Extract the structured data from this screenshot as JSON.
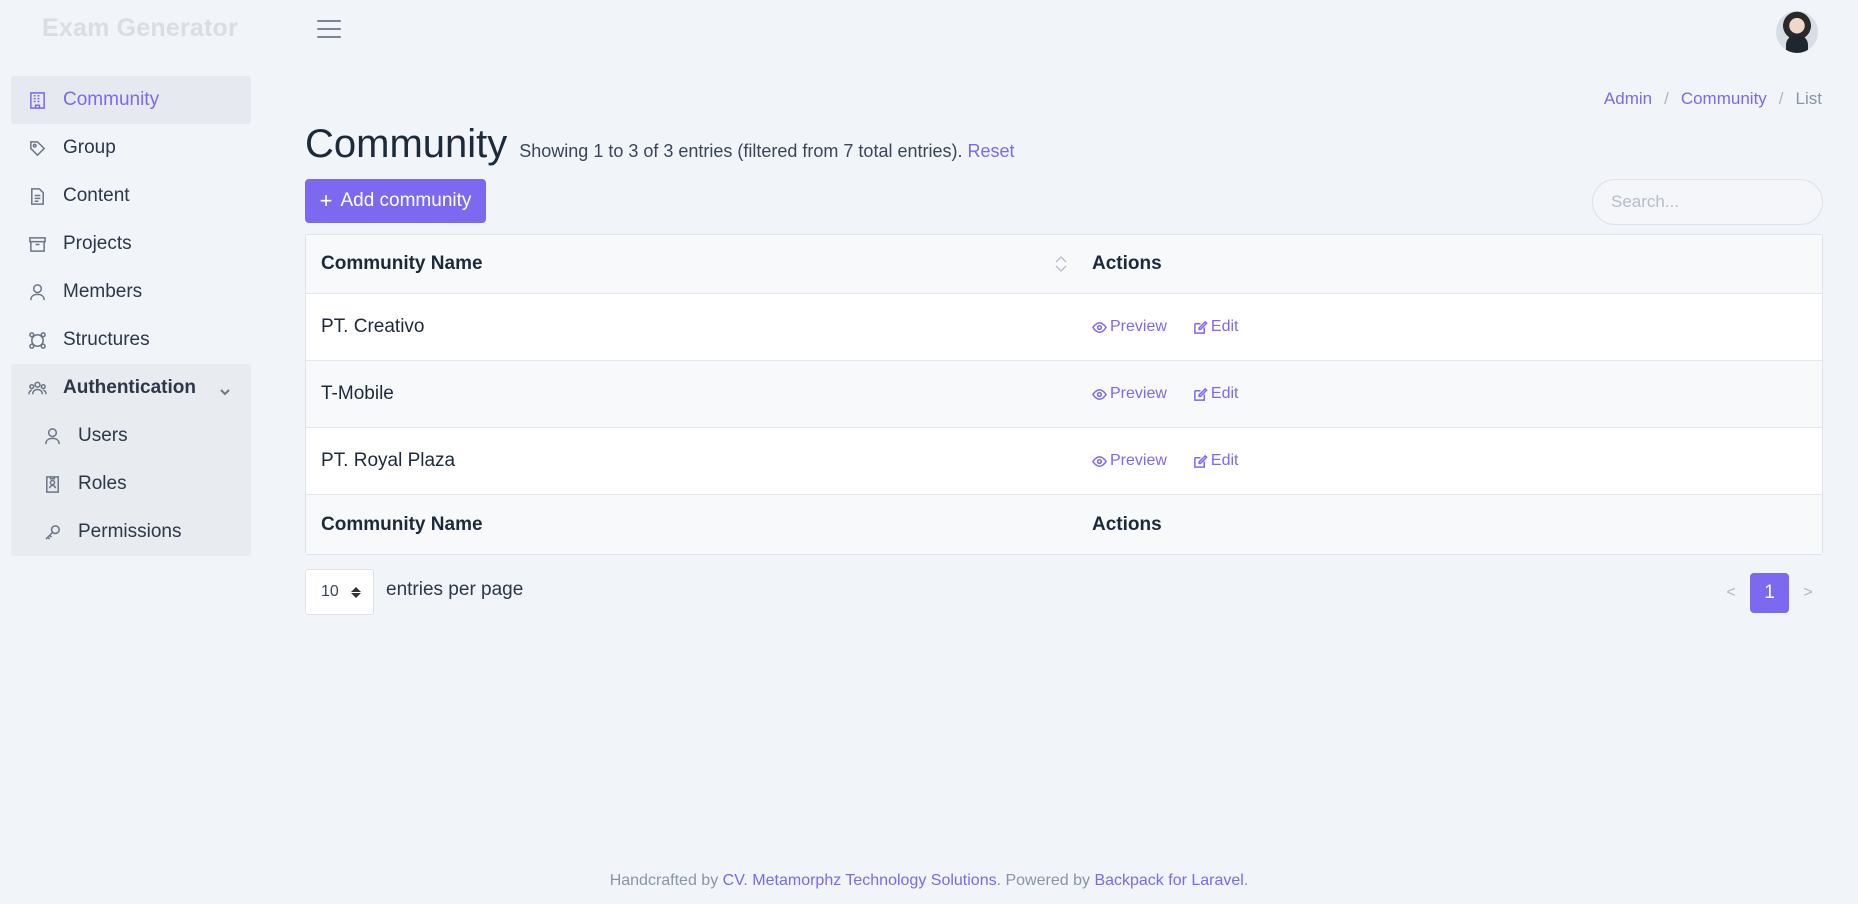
{
  "app": {
    "brand": "Exam Generator"
  },
  "sidebar": {
    "items": [
      {
        "label": "Community",
        "icon": "building-icon",
        "active": true
      },
      {
        "label": "Group",
        "icon": "tag-icon"
      },
      {
        "label": "Content",
        "icon": "document-icon"
      },
      {
        "label": "Projects",
        "icon": "archive-icon"
      },
      {
        "label": "Members",
        "icon": "user-icon"
      },
      {
        "label": "Structures",
        "icon": "network-icon"
      }
    ],
    "auth": {
      "label": "Authentication",
      "icon": "users-group-icon",
      "children": [
        {
          "label": "Users",
          "icon": "user-icon"
        },
        {
          "label": "Roles",
          "icon": "id-badge-icon"
        },
        {
          "label": "Permissions",
          "icon": "key-icon"
        }
      ]
    }
  },
  "breadcrumb": {
    "admin": "Admin",
    "community": "Community",
    "current": "List",
    "sep": "/"
  },
  "page": {
    "title": "Community",
    "subtitle": "Showing 1 to 3 of 3 entries (filtered from 7 total entries).",
    "reset": "Reset",
    "add_button": "Add community",
    "search_placeholder": "Search..."
  },
  "table": {
    "columns": [
      "Community Name",
      "Actions"
    ],
    "rows": [
      {
        "name": "PT. Creativo"
      },
      {
        "name": "T-Mobile"
      },
      {
        "name": "PT. Royal Plaza"
      }
    ],
    "preview_label": "Preview",
    "edit_label": "Edit"
  },
  "pagination": {
    "per_page": "10",
    "per_page_label": "entries per page",
    "prev": "<",
    "current": "1",
    "next": ">"
  },
  "footer": {
    "prefix": "Handcrafted by",
    "company": "CV. Metamorphz Technology Solutions",
    "middle": ". Powered by",
    "framework": "Backpack for Laravel",
    "suffix": "."
  },
  "colors": {
    "accent": "#7c69ef",
    "background": "#f1f4f8"
  }
}
